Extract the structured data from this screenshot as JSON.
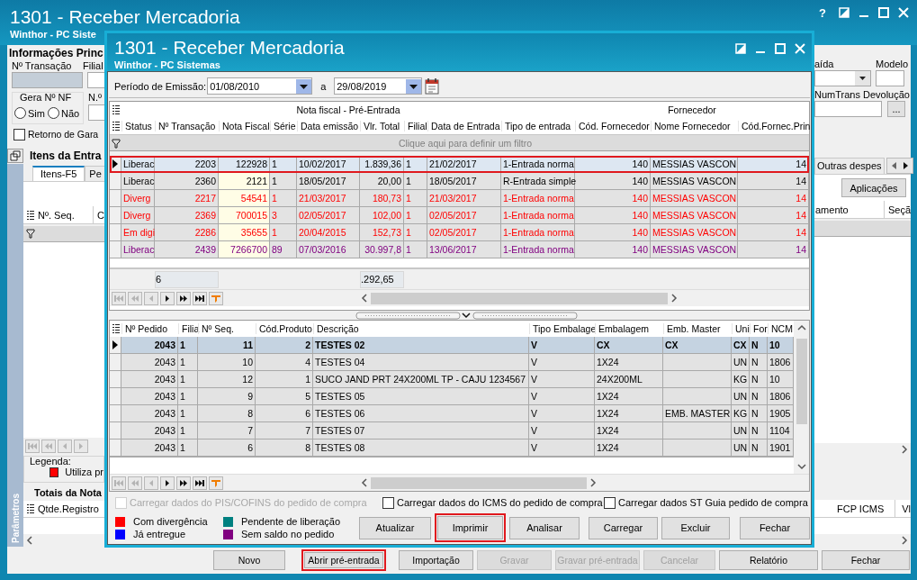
{
  "main_window": {
    "title": "1301 - Receber Mercadoria",
    "subtitle": "Winthor - PC Siste",
    "help_button": "?"
  },
  "header_form": {
    "group_title": "Informações Princ",
    "transaction_label": "Nº Transação",
    "branch_label": "Filial",
    "nf_group": {
      "title": "Gera Nº NF",
      "options": [
        {
          "label": "Sim",
          "selected": false
        },
        {
          "label": "Não",
          "selected": false
        }
      ]
    },
    "number_label": "N.º",
    "warranty_checkbox": {
      "label": "Retorno de Gara",
      "checked": false
    },
    "exit_label": "aída",
    "model_label": "Modelo",
    "return_label": "NumTrans Devolução",
    "lookup_button": "..."
  },
  "items_panel": {
    "title": "Itens da Entra",
    "tabs": [
      {
        "label": "Itens-F5",
        "selected": true
      },
      {
        "label": "Pe",
        "selected": false
      },
      {
        "label": "Outras despes",
        "selected": false
      }
    ],
    "applications_button": "Aplicações",
    "columns_left": [
      "Nº. Seq.",
      "C"
    ],
    "columns_right": [
      "amento",
      "Seçã"
    ],
    "navigator": [
      {
        "kind": "first",
        "disabled": true
      },
      {
        "kind": "prior-page",
        "disabled": true
      },
      {
        "kind": "prior",
        "disabled": true
      },
      {
        "kind": "next",
        "disabled": true
      }
    ]
  },
  "legend": {
    "title": "Legenda:",
    "items": [
      {
        "label": "Utiliza pr",
        "color": "#ff0000"
      }
    ]
  },
  "side_tab": "Parâmetros",
  "totals_panel": {
    "title": "Totais da Nota",
    "columns_left": [
      "Qtde.Registro"
    ],
    "columns_right": [
      "FCP ICMS",
      "Vl"
    ]
  },
  "toolbar": [
    {
      "label": "Novo",
      "disabled": false,
      "highlighted": false
    },
    {
      "label": "Abrir pré-entrada",
      "disabled": false,
      "highlighted": true
    },
    {
      "label": "Importação",
      "disabled": false,
      "highlighted": false
    },
    {
      "label": "Gravar",
      "disabled": true,
      "highlighted": false
    },
    {
      "label": "Gravar pré-entrada",
      "disabled": true,
      "highlighted": false
    },
    {
      "label": "Cancelar",
      "disabled": true,
      "highlighted": false
    },
    {
      "label": "Relatório",
      "disabled": false,
      "highlighted": false
    },
    {
      "label": "Fechar",
      "disabled": false,
      "highlighted": false
    }
  ],
  "dialog": {
    "title": "1301 - Receber Mercadoria",
    "subtitle": "Winthor - PC Sistemas",
    "period": {
      "label": "Período de Emissão:",
      "from": "01/08/2010",
      "separator": "a",
      "to": "29/08/2019"
    },
    "notes_grid": {
      "groups": [
        "Nota fiscal - Pré-Entrada",
        "Fornecedor"
      ],
      "columns": [
        "Status",
        "Nº Transação",
        "Nota Fiscal",
        "Série",
        "Data emissão",
        "Vlr. Total",
        "Filial",
        "Data de Entrada",
        "Tipo de entrada",
        "Cód. Fornecedor",
        "Nome Fornecedor",
        "Cód.Fornec.Prin"
      ],
      "filter_hint": "Clique aqui para definir um filtro",
      "rows": [
        {
          "selected": true,
          "highlighted": true,
          "color": "#000000",
          "cells": [
            "Liberac",
            "2203",
            "122928",
            "1",
            "10/02/2017",
            "1.839,36",
            "1",
            "21/02/2017",
            "1-Entrada norma",
            "140",
            "MESSIAS VASCON",
            "14"
          ]
        },
        {
          "selected": false,
          "highlighted": false,
          "color": "#000000",
          "cells": [
            "Liberac",
            "2360",
            "2121",
            "1",
            "18/05/2017",
            "20,00",
            "1",
            "18/05/2017",
            "R-Entrada simple",
            "140",
            "MESSIAS VASCON",
            "14"
          ]
        },
        {
          "selected": false,
          "highlighted": false,
          "color": "#ff0000",
          "cells": [
            "Diverg",
            "2217",
            "54541",
            "1",
            "21/03/2017",
            "180,73",
            "1",
            "21/03/2017",
            "1-Entrada norma",
            "140",
            "MESSIAS VASCON",
            "14"
          ]
        },
        {
          "selected": false,
          "highlighted": false,
          "color": "#ff0000",
          "cells": [
            "Diverg",
            "2369",
            "700015",
            "3",
            "02/05/2017",
            "102,00",
            "1",
            "02/05/2017",
            "1-Entrada norma",
            "140",
            "MESSIAS VASCON",
            "14"
          ]
        },
        {
          "selected": false,
          "highlighted": false,
          "color": "#ff0000",
          "cells": [
            "Em digi",
            "2286",
            "35655",
            "1",
            "20/04/2015",
            "152,73",
            "1",
            "02/05/2017",
            "1-Entrada norma",
            "140",
            "MESSIAS VASCON",
            "14"
          ]
        },
        {
          "selected": false,
          "highlighted": false,
          "color": "#800080",
          "cells": [
            "Liberac",
            "2439",
            "7266700",
            "89",
            "07/03/2016",
            "30.997,8",
            "1",
            "13/06/2017",
            "1-Entrada norma",
            "140",
            "MESSIAS VASCON",
            "14"
          ]
        }
      ],
      "totals": {
        "count": "6",
        "total": ".292,65"
      },
      "navigator": [
        {
          "kind": "first",
          "disabled": true
        },
        {
          "kind": "prior-page",
          "disabled": true
        },
        {
          "kind": "prior",
          "disabled": true
        },
        {
          "kind": "next",
          "disabled": false
        },
        {
          "kind": "next-page",
          "disabled": false
        },
        {
          "kind": "last",
          "disabled": false
        },
        {
          "kind": "filter",
          "disabled": false
        }
      ]
    },
    "items_grid": {
      "columns": [
        "Nº Pedido",
        "Filia",
        "Nº Seq.",
        "Cód.Produto",
        "Descrição",
        "Tipo Embalage",
        "Embalagem",
        "Emb. Master",
        "Uni",
        "For",
        "NCM"
      ],
      "rows": [
        {
          "selected": true,
          "cells": [
            "2043",
            "1",
            "11",
            "2",
            "TESTES 02",
            "V",
            "CX",
            "CX",
            "CX",
            "N",
            "10"
          ]
        },
        {
          "selected": false,
          "cells": [
            "2043",
            "1",
            "10",
            "4",
            "TESTES 04",
            "V",
            "1X24",
            "",
            "UN",
            "N",
            "1806"
          ]
        },
        {
          "selected": false,
          "cells": [
            "2043",
            "1",
            "12",
            "1",
            "SUCO JAND PRT 24X200ML TP - CAJU 1234567",
            "V",
            "24X200ML",
            "",
            "KG",
            "N",
            "10"
          ]
        },
        {
          "selected": false,
          "cells": [
            "2043",
            "1",
            "9",
            "5",
            "TESTES 05",
            "V",
            "1X24",
            "",
            "UN",
            "N",
            "1806"
          ]
        },
        {
          "selected": false,
          "cells": [
            "2043",
            "1",
            "8",
            "6",
            "TESTES 06",
            "V",
            "1X24",
            "EMB. MASTER",
            "KG",
            "N",
            "1905"
          ]
        },
        {
          "selected": false,
          "cells": [
            "2043",
            "1",
            "7",
            "7",
            "TESTES 07",
            "V",
            "1X24",
            "",
            "UN",
            "N",
            "1104"
          ]
        },
        {
          "selected": false,
          "cells": [
            "2043",
            "1",
            "6",
            "8",
            "TESTES 08",
            "V",
            "1X24",
            "",
            "UN",
            "N",
            "1901"
          ]
        }
      ],
      "navigator": [
        {
          "kind": "first",
          "disabled": true
        },
        {
          "kind": "prior-page",
          "disabled": true
        },
        {
          "kind": "prior",
          "disabled": true
        },
        {
          "kind": "next",
          "disabled": false
        },
        {
          "kind": "next-page",
          "disabled": false
        },
        {
          "kind": "last",
          "disabled": false
        },
        {
          "kind": "filter",
          "disabled": false
        }
      ]
    },
    "options": [
      {
        "label": "Carregar dados do PIS/COFINS do pedido de compra",
        "checked": false,
        "disabled": true
      },
      {
        "label": "Carregar dados do ICMS do pedido de compra",
        "checked": false,
        "disabled": false
      },
      {
        "label": "Carregar dados ST Guia pedido de compra",
        "checked": false,
        "disabled": false
      }
    ],
    "legend": [
      {
        "label": "Com divergência",
        "color": "#ff0000"
      },
      {
        "label": "Pendente de liberação",
        "color": "#008080"
      },
      {
        "label": "Já entregue",
        "color": "#0000ff"
      },
      {
        "label": "Sem saldo no pedido",
        "color": "#800080"
      }
    ],
    "buttons": [
      {
        "label": "Atualizar",
        "highlighted": false
      },
      {
        "label": "Imprimir",
        "highlighted": true
      },
      {
        "label": "Analisar",
        "highlighted": false
      },
      {
        "label": "Carregar",
        "highlighted": false
      },
      {
        "label": "Excluir",
        "highlighted": false
      },
      {
        "label": "Fechar",
        "highlighted": false
      }
    ]
  }
}
